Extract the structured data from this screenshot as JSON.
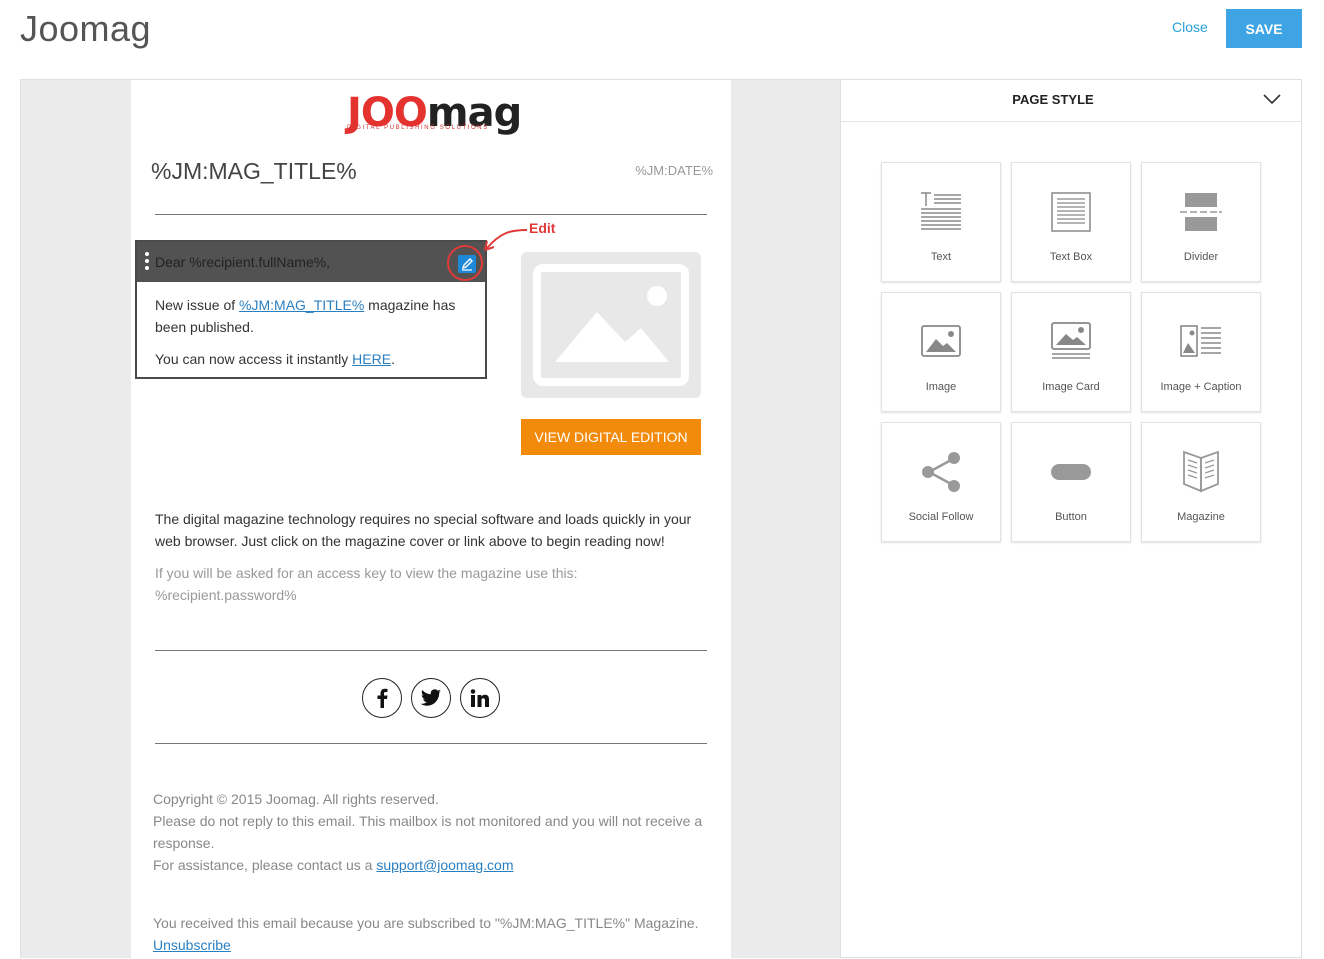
{
  "header": {
    "app_title": "Joomag",
    "close_label": "Close",
    "save_label": "SAVE"
  },
  "email": {
    "logo": {
      "word_red": "JOO",
      "word_dark": "mag",
      "tagline": "DIGITAL PUBLISHING SOLUTIONS"
    },
    "mag_title": "%JM:MAG_TITLE%",
    "date": "%JM:DATE%",
    "text_block": {
      "greeting": "Dear %recipient.fullName%,",
      "line1_pre": "New issue of ",
      "line1_link": "%JM:MAG_TITLE%",
      "line1_post": " magazine has been published.",
      "line2_pre": "You can now access it instantly ",
      "line2_link": "HERE",
      "line2_post": "."
    },
    "edit_annotation": "Edit",
    "view_button": "VIEW DIGITAL EDITION",
    "description": "The digital magazine technology requires no special software and loads quickly in your web browser. Just click on the magazine cover or link above to begin reading now!",
    "access_note": "If you will be asked for an access key to view the magazine use this: %recipient.password%",
    "socials": [
      {
        "icon": "facebook-icon",
        "glyph": "f"
      },
      {
        "icon": "twitter-icon",
        "glyph": "t"
      },
      {
        "icon": "linkedin-icon",
        "glyph": "in"
      }
    ],
    "footer": {
      "copyright": "Copyright © 2015 Joomag. All rights reserved.",
      "noreply": "Please do not reply to this email. This mailbox is not monitored and you will not receive a response.",
      "assist_pre": "For assistance, please contact us a ",
      "assist_link": "support@joomag.com",
      "subscribed": "You received this email because you are subscribed to \"%JM:MAG_TITLE%\" Magazine.",
      "unsubscribe": "Unsubscribe"
    }
  },
  "panel": {
    "title": "PAGE STYLE",
    "tiles": [
      {
        "label": "Text",
        "icon": "text-icon"
      },
      {
        "label": "Text Box",
        "icon": "text-box-icon"
      },
      {
        "label": "Divider",
        "icon": "divider-icon"
      },
      {
        "label": "Image",
        "icon": "image-icon"
      },
      {
        "label": "Image Card",
        "icon": "image-card-icon"
      },
      {
        "label": "Image + Caption",
        "icon": "image-caption-icon"
      },
      {
        "label": "Social Follow",
        "icon": "share-icon"
      },
      {
        "label": "Button",
        "icon": "button-icon"
      },
      {
        "label": "Magazine",
        "icon": "magazine-icon"
      }
    ]
  },
  "colors": {
    "accent_blue": "#3ea4e4",
    "cta_orange": "#f28a0c",
    "annotation_red": "#e03a3a"
  }
}
